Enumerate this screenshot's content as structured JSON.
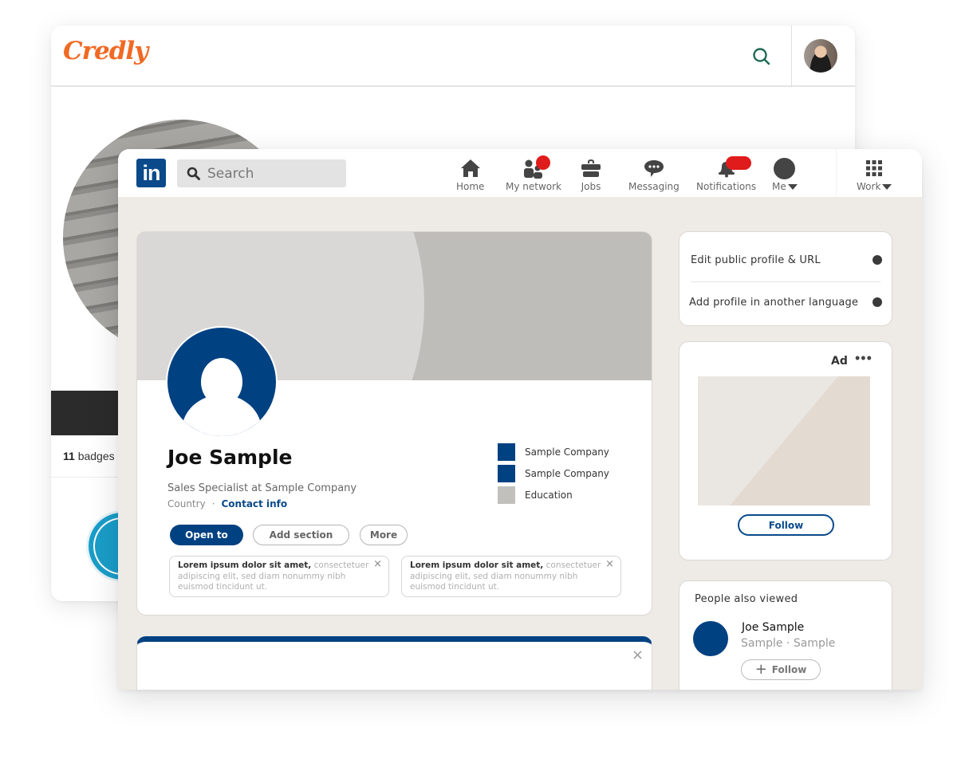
{
  "credly": {
    "logo": "Credly",
    "badges_count": "11",
    "badges_label": "badges",
    "colors": {
      "brand": "#f06a24",
      "search_icon": "#1e6b52"
    }
  },
  "linkedin": {
    "search": {
      "placeholder": "Search"
    },
    "nav": [
      {
        "label": "Home",
        "icon": "home-icon"
      },
      {
        "label": "My network",
        "icon": "people-icon",
        "notification": true
      },
      {
        "label": "Jobs",
        "icon": "briefcase-icon"
      },
      {
        "label": "Messaging",
        "icon": "chat-icon"
      },
      {
        "label": "Notifications",
        "icon": "bell-icon",
        "notification": true
      },
      {
        "label": "Me",
        "icon": "avatar-icon",
        "dropdown": true
      },
      {
        "label": "Work",
        "icon": "grid-icon",
        "dropdown": true
      }
    ],
    "profile": {
      "name": "Joe Sample",
      "headline": "Sales Specialist at Sample Company",
      "location": "Country",
      "separator": "·",
      "contact_link": "Contact info",
      "buttons": {
        "open_to": "Open to",
        "add_section": "Add section",
        "more": "More"
      },
      "experience": [
        {
          "label": "Sample Company",
          "color": "#004182"
        },
        {
          "label": "Sample Company",
          "color": "#004182"
        },
        {
          "label": "Education",
          "color": "#c2c0bd"
        }
      ],
      "notes": [
        {
          "bold": "Lorem ipsum dolor sit amet,",
          "rest": " consectetuer adipiscing elit, sed diam nonummy nibh euismod tincidunt ut."
        },
        {
          "bold": "Lorem ipsum dolor sit amet,",
          "rest": " consectetuer adipiscing elit, sed diam nonummy nibh euismod tincidunt ut."
        }
      ],
      "close_glyph": "×"
    },
    "sidebar": {
      "links": [
        "Edit public profile & URL",
        "Add profile in another language"
      ],
      "ad": {
        "label": "Ad",
        "more": "•••",
        "follow": "Follow"
      },
      "people_also_viewed": {
        "title": "People also viewed",
        "person": {
          "name": "Joe Sample",
          "subtitle": "Sample · Sample",
          "follow": "Follow",
          "plus": "+"
        }
      }
    },
    "colors": {
      "brand": "#0a4a8a",
      "accent_dark": "#004182",
      "notification": "#e01b1b",
      "background": "#eeebe7"
    }
  }
}
